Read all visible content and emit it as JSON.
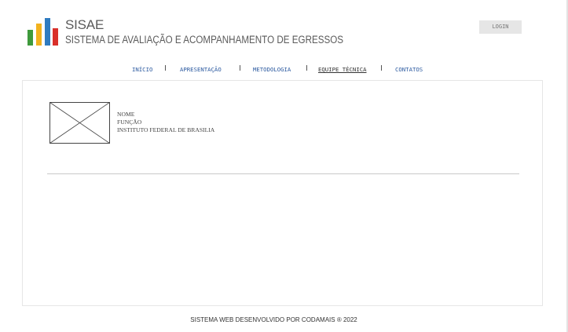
{
  "header": {
    "brand_title": "SISAE",
    "brand_subtitle": "SISTEMA DE AVALIAÇÃO E ACOMPANHAMENTO DE EGRESSOS",
    "login_label": "LOGIN"
  },
  "nav": {
    "items": [
      {
        "label": "INÍCIO"
      },
      {
        "label": "APRESENTAÇÃO"
      },
      {
        "label": "METODOLOGIA"
      },
      {
        "label": "EQUIPE TÉCNICA",
        "active": true
      },
      {
        "label": "CONTATOS"
      }
    ]
  },
  "team": {
    "members": [
      {
        "name": "NOME",
        "role": "FUNÇÃO",
        "institution": "INSTITUTO FEDERAL DE BRASILIA"
      }
    ]
  },
  "footer": {
    "text": "SISTEMA WEB DESENVOLVIDO POR CODAMAIS ® 2022"
  },
  "colors": {
    "nav_link": "#2c5aa0",
    "logo_green": "#3f9a3c",
    "logo_yellow": "#f2b21e",
    "logo_blue": "#2f7bc0",
    "logo_red": "#d9302a"
  }
}
